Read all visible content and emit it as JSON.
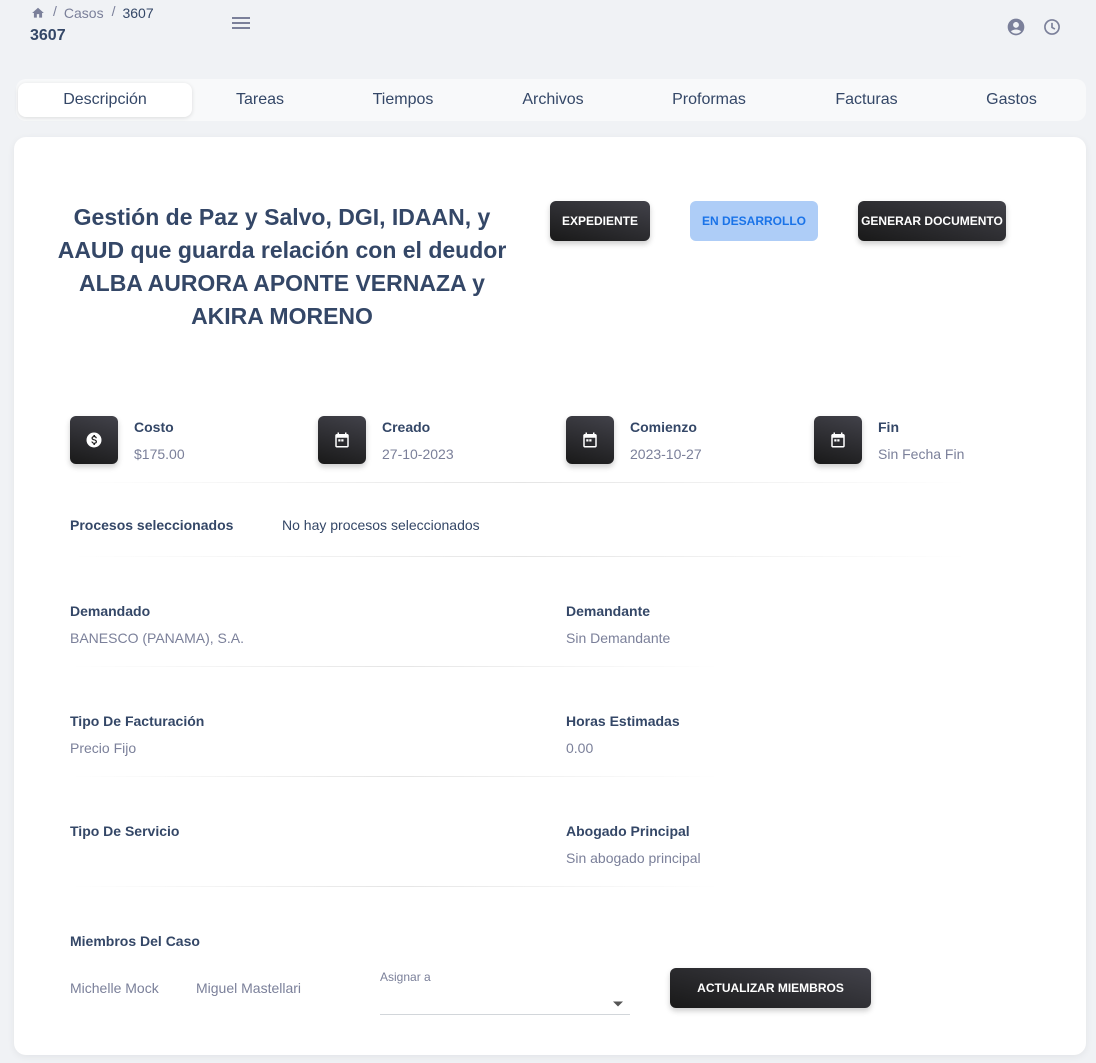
{
  "breadcrumb": {
    "link": "Casos",
    "current": "3607"
  },
  "page_title": "3607",
  "tabs": [
    {
      "label": "Descripción",
      "active": true
    },
    {
      "label": "Tareas"
    },
    {
      "label": "Tiempos"
    },
    {
      "label": "Archivos"
    },
    {
      "label": "Proformas"
    },
    {
      "label": "Facturas"
    },
    {
      "label": "Gastos"
    }
  ],
  "case": {
    "title": "Gestión de Paz y Salvo, DGI, IDAAN, y AAUD que guarda relación con el deudor ALBA AURORA APONTE VERNAZA y AKIRA MORENO",
    "expediente_button": "EXPEDIENTE",
    "status": "EN DESARROLLO",
    "generate_button": "GENERAR DOCUMENTO"
  },
  "stats": [
    {
      "icon": "dollar-icon",
      "label": "Costo",
      "value": "$175.00"
    },
    {
      "icon": "calendar-icon",
      "label": "Creado",
      "value": "27-10-2023"
    },
    {
      "icon": "calendar-icon",
      "label": "Comienzo",
      "value": "2023-10-27"
    },
    {
      "icon": "calendar-icon",
      "label": "Fin",
      "value": "Sin Fecha Fin"
    }
  ],
  "procesos": {
    "label": "Procesos seleccionados",
    "value": "No hay procesos seleccionados"
  },
  "fields": {
    "demandado": {
      "label": "Demandado",
      "value": "BANESCO (PANAMA), S.A."
    },
    "demandante": {
      "label": "Demandante",
      "value": "Sin Demandante"
    },
    "tipo_facturacion": {
      "label": "Tipo De Facturación",
      "value": "Precio Fijo"
    },
    "horas_estimadas": {
      "label": "Horas Estimadas",
      "value": "0.00"
    },
    "tipo_servicio": {
      "label": "Tipo De Servicio",
      "value": ""
    },
    "abogado_principal": {
      "label": "Abogado Principal",
      "value": "Sin abogado principal"
    }
  },
  "members": {
    "label": "Miembros Del Caso",
    "list": [
      "Michelle Mock",
      "Miguel Mastellari"
    ],
    "assign_label": "Asignar a",
    "assign_value": "",
    "update_button": "ACTUALIZAR MIEMBROS"
  },
  "colors": {
    "text_primary": "#344767",
    "text_secondary": "#7b809a",
    "status_bg": "#aecdf7",
    "status_text": "#1a73e8",
    "dark_button": "#191919"
  }
}
